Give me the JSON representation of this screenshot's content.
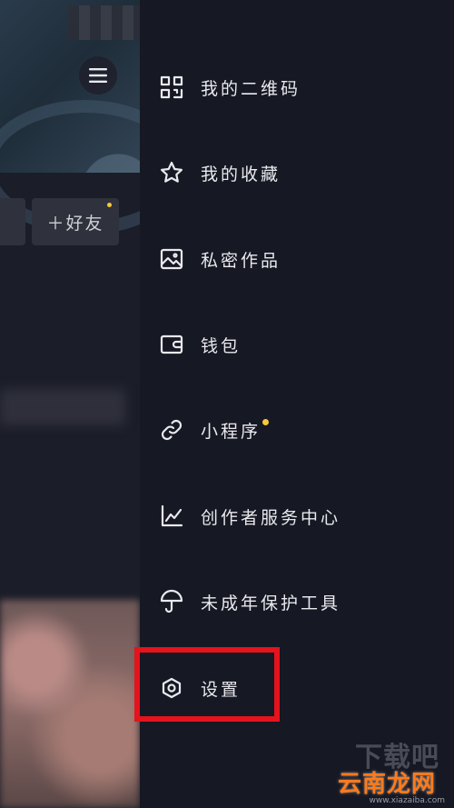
{
  "left_panel": {
    "friend_button_label": "＋好友"
  },
  "drawer": {
    "items": [
      {
        "label": "我的二维码",
        "icon": "qr-code-icon"
      },
      {
        "label": "我的收藏",
        "icon": "star-icon"
      },
      {
        "label": "私密作品",
        "icon": "image-icon"
      },
      {
        "label": "钱包",
        "icon": "wallet-icon"
      },
      {
        "label": "小程序",
        "icon": "link-icon",
        "badge": true
      },
      {
        "label": "创作者服务中心",
        "icon": "chart-icon"
      },
      {
        "label": "未成年保护工具",
        "icon": "umbrella-icon"
      },
      {
        "label": "设置",
        "icon": "settings-icon"
      }
    ]
  },
  "watermark": {
    "text": "下载吧",
    "logo": "云南龙网",
    "sub": "www.xiazaiba.com"
  },
  "colors": {
    "background": "#161823",
    "highlight": "#e5131c",
    "badge": "#f6c83a",
    "text": "#e9e9ee"
  }
}
